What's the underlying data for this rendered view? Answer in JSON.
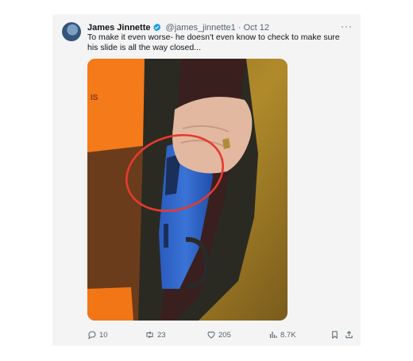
{
  "tweet": {
    "author_name": "James Jinnette",
    "handle": "@james_jinnette1",
    "separator": "·",
    "date": "Oct 12",
    "more": "···",
    "text": "To make it even worse- he doesn't even know to check to make sure his slide is all the way closed...",
    "vest_text": "IS"
  },
  "actions": {
    "replies": "10",
    "retweets": "23",
    "likes": "205",
    "views": "8.7K"
  },
  "colors": {
    "verified": "#1d9bf0",
    "annotation_circle": "#e53a2e",
    "gun_blue": "#2f66c9",
    "vest_orange": "#f47a1a"
  },
  "icons": [
    "verified-badge-icon",
    "more-options-icon",
    "reply-icon",
    "retweet-icon",
    "like-icon",
    "views-icon",
    "bookmark-icon",
    "share-icon"
  ]
}
